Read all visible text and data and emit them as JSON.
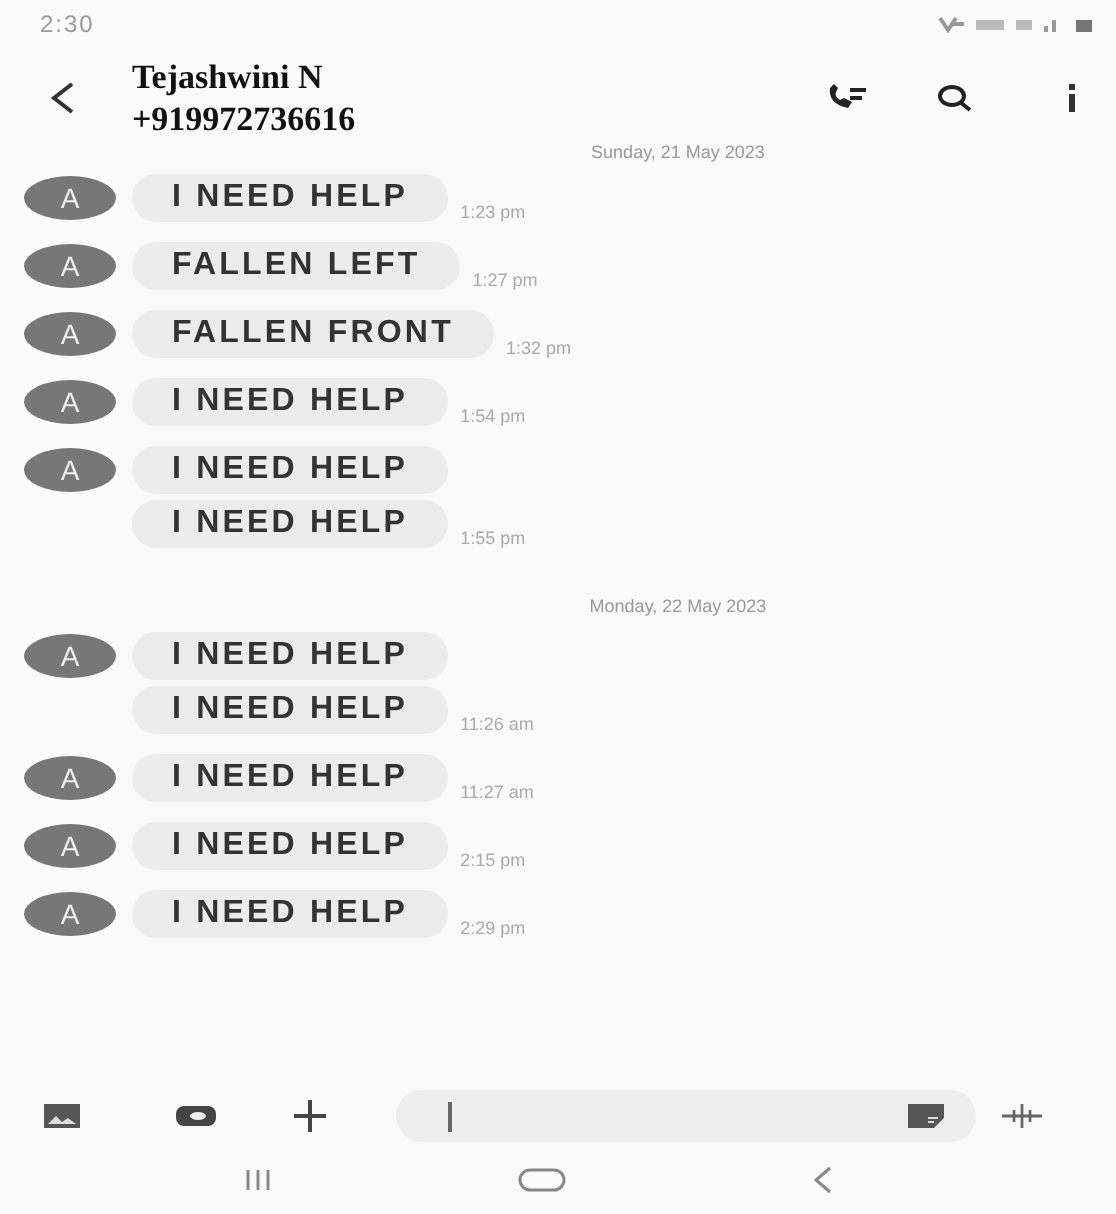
{
  "status_bar": {
    "time": "2:30"
  },
  "header": {
    "name": "Tejashwini N",
    "number": "+919972736616"
  },
  "days": [
    {
      "date": "Sunday, 21 May 2023",
      "groups": [
        {
          "avatar": "A",
          "messages": [
            "I NEED HELP"
          ],
          "time": "1:23 pm"
        },
        {
          "avatar": "A",
          "messages": [
            "FALLEN LEFT"
          ],
          "time": "1:27 pm"
        },
        {
          "avatar": "A",
          "messages": [
            "FALLEN FRONT"
          ],
          "time": "1:32 pm"
        },
        {
          "avatar": "A",
          "messages": [
            "I NEED HELP"
          ],
          "time": "1:54 pm"
        },
        {
          "avatar": "A",
          "messages": [
            "I NEED HELP",
            "I NEED HELP"
          ],
          "time": "1:55 pm"
        }
      ]
    },
    {
      "date": "Monday, 22 May 2023",
      "groups": [
        {
          "avatar": "A",
          "messages": [
            "I NEED HELP",
            "I NEED HELP"
          ],
          "time": "11:26 am"
        },
        {
          "avatar": "A",
          "messages": [
            "I NEED HELP"
          ],
          "time": "11:27 am"
        },
        {
          "avatar": "A",
          "messages": [
            "I NEED HELP"
          ],
          "time": "2:15 pm"
        },
        {
          "avatar": "A",
          "messages": [
            "I NEED HELP"
          ],
          "time": "2:29 pm"
        }
      ]
    }
  ]
}
